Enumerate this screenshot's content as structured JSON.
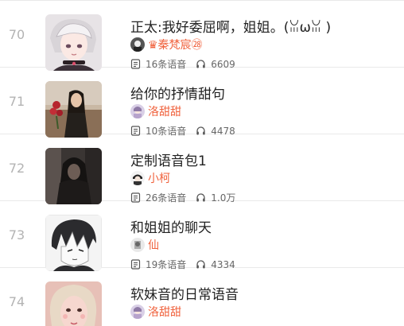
{
  "items": [
    {
      "rank": "70",
      "title": "正太:我好委屈啊，姐姐。(ꈍωꈍ )",
      "author": "♛秦梵宸㉘",
      "voice_count": "16条语音",
      "plays": "6609",
      "thumb_icon": "anime-boy-white-hair-thumbnail",
      "accent": "#f0623d"
    },
    {
      "rank": "71",
      "title": "给你的抒情甜句",
      "author": "洛甜甜",
      "voice_count": "10条语音",
      "plays": "4478",
      "thumb_icon": "girl-with-roses-thumbnail"
    },
    {
      "rank": "72",
      "title": "定制语音包1",
      "author": "小柯",
      "voice_count": "26条语音",
      "plays": "1.0万",
      "thumb_icon": "hooded-figure-thumbnail"
    },
    {
      "rank": "73",
      "title": "和姐姐的聊天",
      "author": "仙",
      "voice_count": "19条语音",
      "plays": "4334",
      "thumb_icon": "anime-boy-dark-hair-thumbnail"
    },
    {
      "rank": "74",
      "title": "软妹音的日常语音",
      "author": "洛甜甜",
      "voice_count": "",
      "plays": "",
      "thumb_icon": "girl-with-cat-filter-thumbnail"
    }
  ]
}
